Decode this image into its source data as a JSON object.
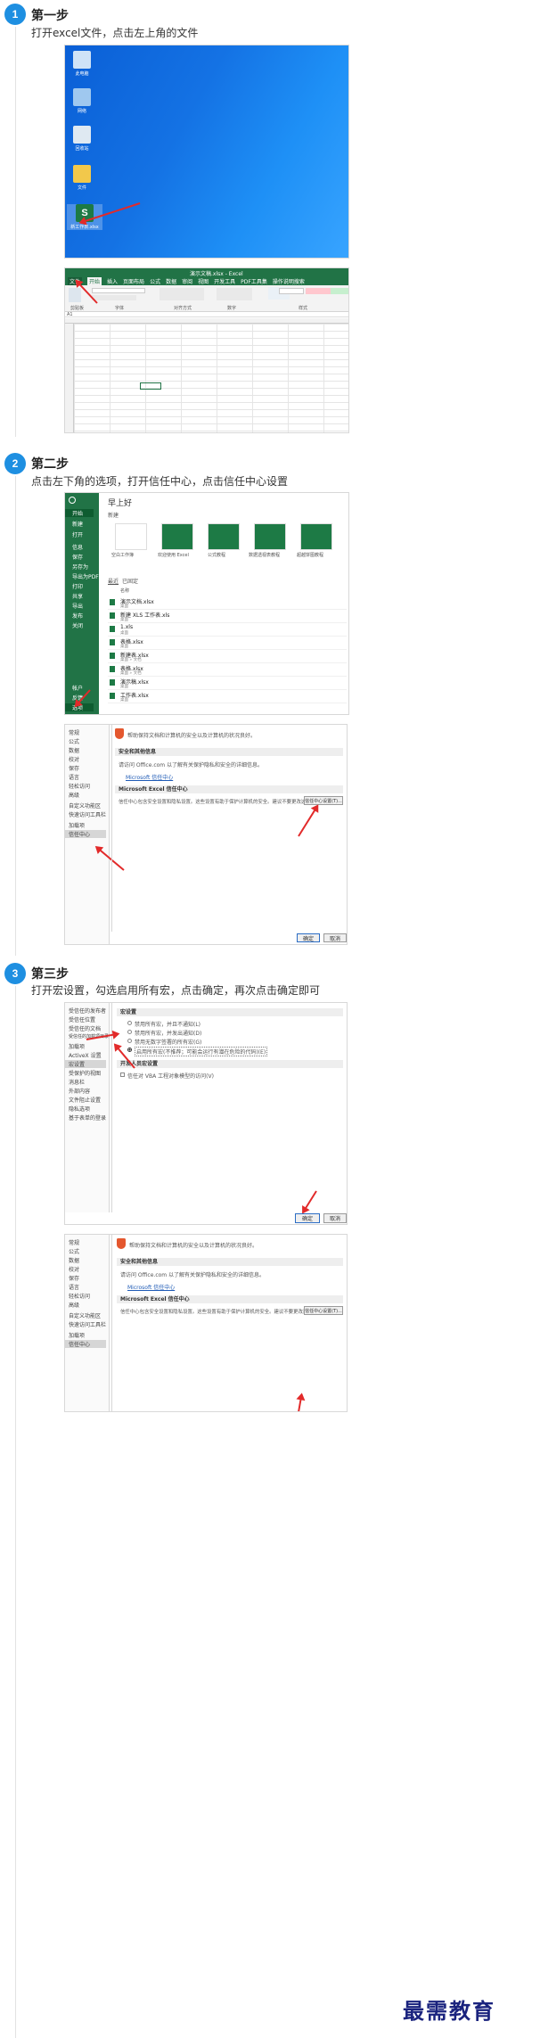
{
  "steps": [
    {
      "number": "1",
      "title": "第一步",
      "desc": "打开excel文件，点击左上角的文件"
    },
    {
      "number": "2",
      "title": "第二步",
      "desc": "点击左下角的选项，打开信任中心，点击信任中心设置"
    },
    {
      "number": "3",
      "title": "第三步",
      "desc": "打开宏设置，勾选启用所有宏，点击确定，再次点击确定即可"
    }
  ],
  "desktop": {
    "icons": [
      {
        "label": "此电脑",
        "color": "#cfe3f7",
        "icon": "computer-icon"
      },
      {
        "label": "网络",
        "color": "#9fc8ef",
        "icon": "network-icon"
      },
      {
        "label": "回收站",
        "color": "#dfe9f2",
        "icon": "recycle-bin-icon"
      },
      {
        "label": "文件",
        "color": "#f2c84b",
        "icon": "folder-icon"
      },
      {
        "label": "新工作表.xlsx",
        "color": "#1d7a45",
        "icon": "excel-file-icon"
      }
    ]
  },
  "excel": {
    "window_title": "演示文稿.xlsx - Excel",
    "tabs": [
      "文件",
      "开始",
      "插入",
      "页面布局",
      "公式",
      "数据",
      "审阅",
      "视图",
      "开发工具",
      "PDF工具集",
      "操作说明搜索"
    ],
    "cell_ref": "A1",
    "groups": [
      "剪贴板",
      "字体",
      "对齐方式",
      "数字",
      "样式"
    ],
    "row_numbers": [
      "1",
      "2",
      "3",
      "4",
      "5",
      "6",
      "7",
      "8",
      "9",
      "10",
      "11",
      "12",
      "13",
      "14",
      "15",
      "16",
      "17",
      "18",
      "19",
      "20",
      "21",
      "22",
      "23",
      "24",
      "25",
      "26",
      "27",
      "28",
      "29",
      "30",
      "31",
      "32",
      "33",
      "34",
      "35",
      "36"
    ]
  },
  "backstage": {
    "greeting": "早上好",
    "new_label": "新建",
    "nav_items": [
      "开始",
      "新建",
      "打开",
      "信息",
      "保存",
      "另存为",
      "导出为PDF",
      "打印",
      "共享",
      "导出",
      "发布",
      "关闭"
    ],
    "nav_bottom": [
      "帐户",
      "反馈",
      "选项"
    ],
    "templates": [
      "空白工作簿",
      "欢迎使用 Excel",
      "公式教程",
      "数据透视表教程",
      "超越饼图教程"
    ],
    "recent_tabs": [
      "最近",
      "已固定"
    ],
    "name_header": "名称",
    "recent_files": [
      {
        "name": "演示文档.xlsx",
        "path": "桌面"
      },
      {
        "name": "新建 XLS 工作表.xls",
        "path": "桌面"
      },
      {
        "name": "1.xls",
        "path": "桌面"
      },
      {
        "name": "表格.xlsx",
        "path": "桌面"
      },
      {
        "name": "新建表.xlsx",
        "path": "桌面 » 文档"
      },
      {
        "name": "表格.xlsx",
        "path": "桌面 » 文档"
      },
      {
        "name": "演示稿.xlsx",
        "path": "桌面"
      },
      {
        "name": "工作表.xlsx",
        "path": "桌面"
      }
    ]
  },
  "trust_options": {
    "nav_items": [
      "常规",
      "公式",
      "数据",
      "校对",
      "保存",
      "语言",
      "轻松访问",
      "高级",
      "自定义功能区",
      "快速访问工具栏",
      "加载项",
      "信任中心"
    ],
    "banner": "帮助保持文档和计算机的安全以及计算机的状况良好。",
    "security_header": "安全和其他信息",
    "security_text": "请访问 Office.com 以了解有关保护隐私和安全的详细信息。",
    "privacy_link": "Microsoft 信任中心",
    "trust_header": "Microsoft Excel 信任中心",
    "trust_text": "信任中心包含安全设置和隐私设置。这些设置有助于保护计算机的安全。建议不要更改这些设置。",
    "trust_button": "信任中心设置(T)...",
    "ok": "确定",
    "cancel": "取消"
  },
  "macro": {
    "nav_items": [
      "受信任的发布者",
      "受信任位置",
      "受信任的文档",
      "受信任的加载项目录",
      "加载项",
      "ActiveX 设置",
      "宏设置",
      "受保护的视图",
      "消息栏",
      "外部内容",
      "文件阻止设置",
      "隐私选项",
      "基于表单的登录"
    ],
    "macro_header": "宏设置",
    "options": [
      "禁用所有宏，并且不通知(L)",
      "禁用所有宏，并发出通知(D)",
      "禁用无数字签署的所有宏(G)",
      "启用所有宏(不推荐；可能会运行有潜在危险的代码)(E)"
    ],
    "dev_header": "开发人员宏设置",
    "dev_option": "信任对 VBA 工程对象模型的访问(V)",
    "ok": "确定",
    "cancel": "取消"
  },
  "watermark": "最需教育"
}
